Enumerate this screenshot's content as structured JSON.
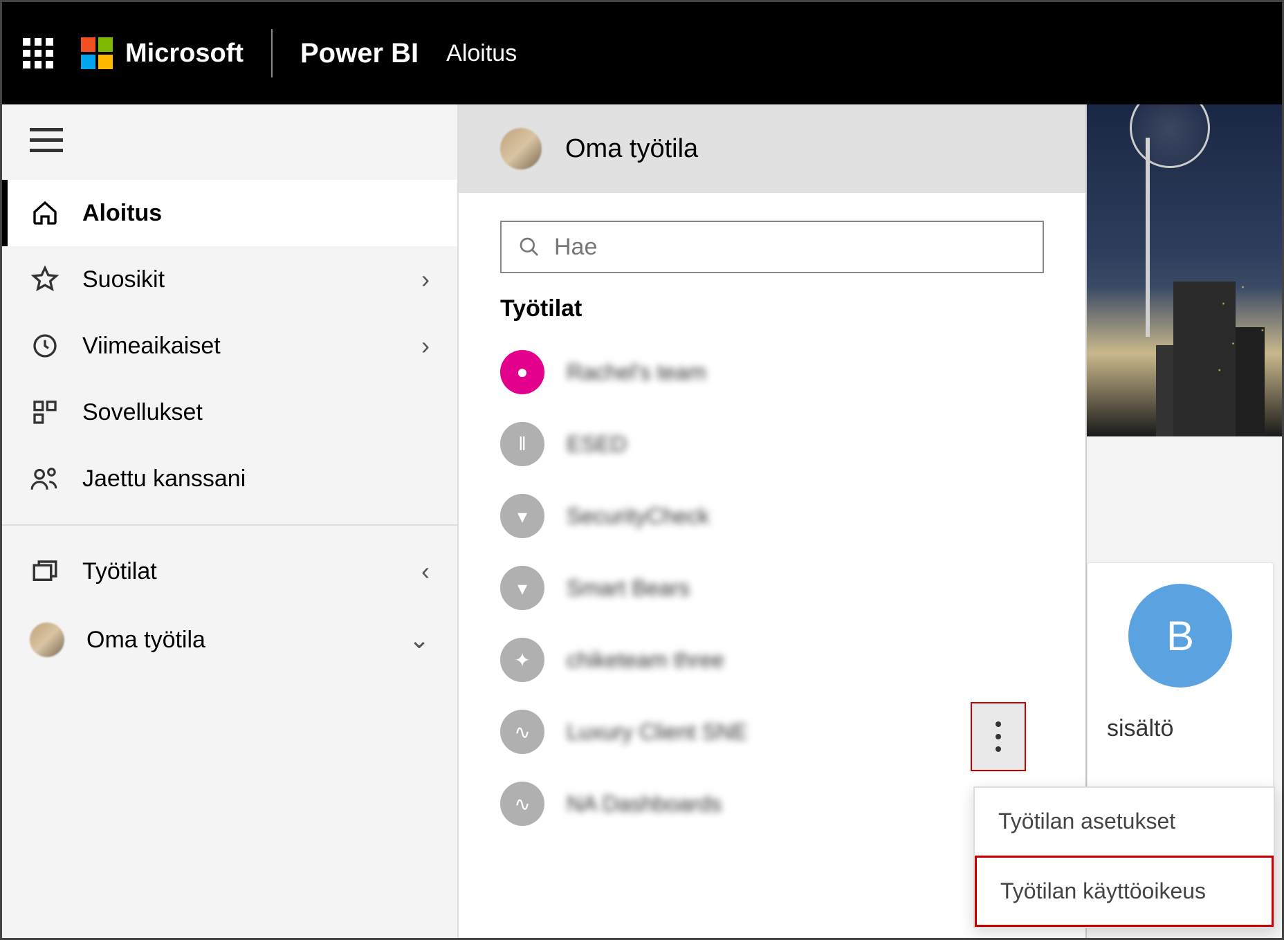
{
  "header": {
    "microsoft": "Microsoft",
    "product": "Power BI",
    "crumb": "Aloitus"
  },
  "sidebar": {
    "items": [
      {
        "label": "Aloitus"
      },
      {
        "label": "Suosikit"
      },
      {
        "label": "Viimeaikaiset"
      },
      {
        "label": "Sovellukset"
      },
      {
        "label": "Jaettu kanssani"
      },
      {
        "label": "Työtilat"
      },
      {
        "label": "Oma työtila"
      }
    ]
  },
  "flyout": {
    "my_workspace": "Oma työtila",
    "search_placeholder": "Hae",
    "section": "Työtilat",
    "workspaces": [
      {
        "label": "Rachel's team"
      },
      {
        "label": "ESED"
      },
      {
        "label": "SecurityCheck"
      },
      {
        "label": "Smart Bears"
      },
      {
        "label": "chiketeam three"
      },
      {
        "label": "Luxury Client SNE"
      },
      {
        "label": "NA Dashboards"
      }
    ]
  },
  "card": {
    "initial": "B",
    "label": "sisältö"
  },
  "context_menu": {
    "settings": "Työtilan asetukset",
    "access": "Työtilan käyttöoikeus"
  }
}
